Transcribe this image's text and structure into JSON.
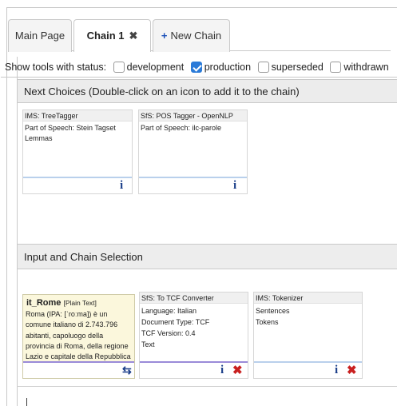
{
  "tabs": [
    {
      "label": "Main Page"
    },
    {
      "label": "Chain 1",
      "close": "✖"
    },
    {
      "label": "New Chain",
      "plus": "+"
    }
  ],
  "status_filter": {
    "label": "Show tools with status:",
    "options": [
      {
        "label": "development",
        "checked": false
      },
      {
        "label": "production",
        "checked": true
      },
      {
        "label": "superseded",
        "checked": false
      },
      {
        "label": "withdrawn",
        "checked": false
      }
    ]
  },
  "next_choices": {
    "header": "Next Choices (Double-click on an icon to add it to the chain)",
    "cards": [
      {
        "title": "IMS: TreeTagger",
        "lines": [
          "Part of Speech: Stein Tagset",
          "Lemmas"
        ],
        "info": "i"
      },
      {
        "title": "SfS: POS Tagger - OpenNLP",
        "lines": [
          "Part of Speech: ilc-parole"
        ],
        "info": "i"
      }
    ]
  },
  "chain_selection": {
    "header": "Input and Chain Selection",
    "input_card": {
      "name": "it_Rome",
      "type": "[Plain Text]",
      "text_lines": [
        "Roma (IPA: [ˈroːma]) è un",
        "comune italiano di 2.743.796",
        "abitanti, capoluogo della",
        "provincia di Roma, della regione",
        "Lazio e capitale della Repubblica"
      ],
      "swap": "⇆"
    },
    "cards": [
      {
        "title": "SfS: To TCF Converter",
        "lines": [
          "Language: Italian",
          "Document Type: TCF",
          "TCF Version: 0.4",
          "Text"
        ],
        "info": "i",
        "delete": "✖"
      },
      {
        "title": "IMS: Tokenizer",
        "lines": [
          "Sentences",
          "Tokens"
        ],
        "info": "i",
        "delete": "✖"
      }
    ]
  }
}
